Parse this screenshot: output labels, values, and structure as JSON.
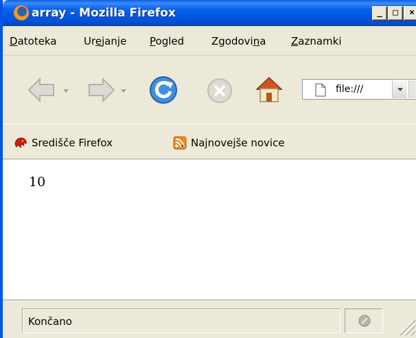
{
  "window": {
    "title": "array - Mozilla Firefox",
    "buttons": {
      "minimize": "_",
      "maximize": "□",
      "close": "×"
    }
  },
  "menu": {
    "items": [
      {
        "label": "Datoteka",
        "accel_index": 0
      },
      {
        "label": "Urejanje",
        "accel_index": 2
      },
      {
        "label": "Pogled",
        "accel_index": 0
      },
      {
        "label": "Zgodovina",
        "accel_index": 7
      },
      {
        "label": "Zaznamki",
        "accel_index": 0
      }
    ]
  },
  "toolbar": {
    "icons": [
      "back-arrow-icon",
      "forward-arrow-icon",
      "reload-icon",
      "stop-icon",
      "home-icon"
    ],
    "address": "file:///"
  },
  "bookmarks": {
    "items": [
      {
        "label": "Središče Firefox",
        "icon": "firefox-central-icon"
      },
      {
        "label": "Najnovejše novice",
        "icon": "rss-feed-icon"
      }
    ]
  },
  "content": {
    "text": "10"
  },
  "status": {
    "text": "Končano"
  },
  "colors": {
    "titlebar": "#0255dd",
    "chrome": "#ece9d8",
    "content_bg": "#ffffff"
  }
}
